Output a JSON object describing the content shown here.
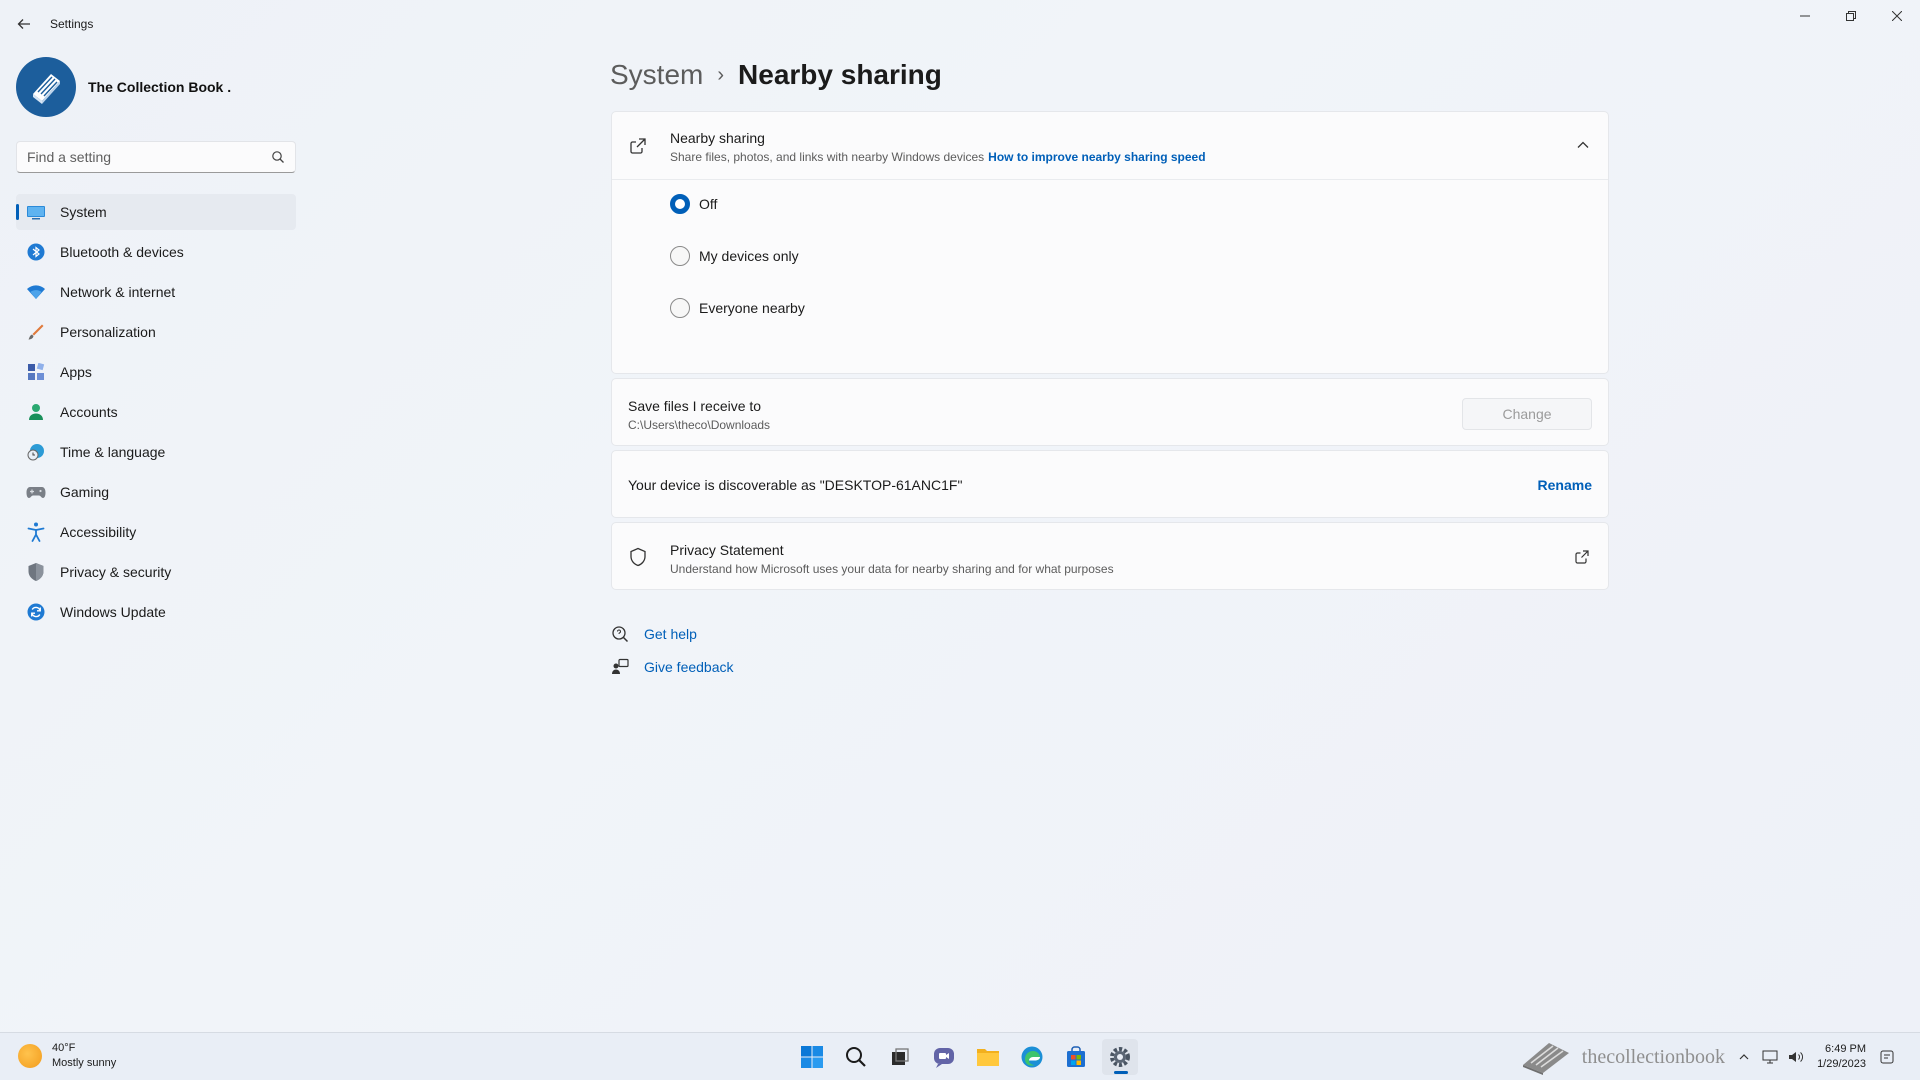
{
  "window": {
    "title": "Settings"
  },
  "profile": {
    "name": "The Collection Book ."
  },
  "search": {
    "placeholder": "Find a setting"
  },
  "sidebar": {
    "items": [
      {
        "label": "System",
        "icon": "display-icon",
        "active": true
      },
      {
        "label": "Bluetooth & devices",
        "icon": "bluetooth-icon"
      },
      {
        "label": "Network & internet",
        "icon": "wifi-icon"
      },
      {
        "label": "Personalization",
        "icon": "brush-icon"
      },
      {
        "label": "Apps",
        "icon": "apps-icon"
      },
      {
        "label": "Accounts",
        "icon": "person-icon"
      },
      {
        "label": "Time & language",
        "icon": "globe-clock-icon"
      },
      {
        "label": "Gaming",
        "icon": "gamepad-icon"
      },
      {
        "label": "Accessibility",
        "icon": "accessibility-icon"
      },
      {
        "label": "Privacy & security",
        "icon": "shield-icon"
      },
      {
        "label": "Windows Update",
        "icon": "refresh-icon"
      }
    ]
  },
  "breadcrumb": {
    "parent": "System",
    "separator": "›",
    "current": "Nearby sharing"
  },
  "nearby_sharing": {
    "title": "Nearby sharing",
    "description": "Share files, photos, and links with nearby Windows devices",
    "link": "How to improve nearby sharing speed",
    "expanded": true,
    "options": [
      {
        "label": "Off",
        "selected": true
      },
      {
        "label": "My devices only",
        "selected": false
      },
      {
        "label": "Everyone nearby",
        "selected": false
      }
    ]
  },
  "save_files": {
    "title": "Save files I receive to",
    "path": "C:\\Users\\theco\\Downloads",
    "button": "Change"
  },
  "discoverable": {
    "text": "Your device is discoverable as \"DESKTOP-61ANC1F\"",
    "action": "Rename"
  },
  "privacy": {
    "title": "Privacy Statement",
    "description": "Understand how Microsoft uses your data for nearby sharing and for what purposes"
  },
  "help_links": {
    "get_help": "Get help",
    "give_feedback": "Give feedback"
  },
  "taskbar": {
    "weather_temp": "40°F",
    "weather_desc": "Mostly sunny",
    "apps": [
      "start-icon",
      "search-icon",
      "task-view-icon",
      "chat-icon",
      "file-explorer-icon",
      "edge-icon",
      "store-icon",
      "settings-icon"
    ],
    "active_app": "settings-icon",
    "tray_brand": "thecollectionbook",
    "time": "6:49 PM",
    "date": "1/29/2023"
  },
  "colors": {
    "accent": "#005fb8",
    "background": "#eef2f7",
    "card": "#fbfbfc"
  }
}
